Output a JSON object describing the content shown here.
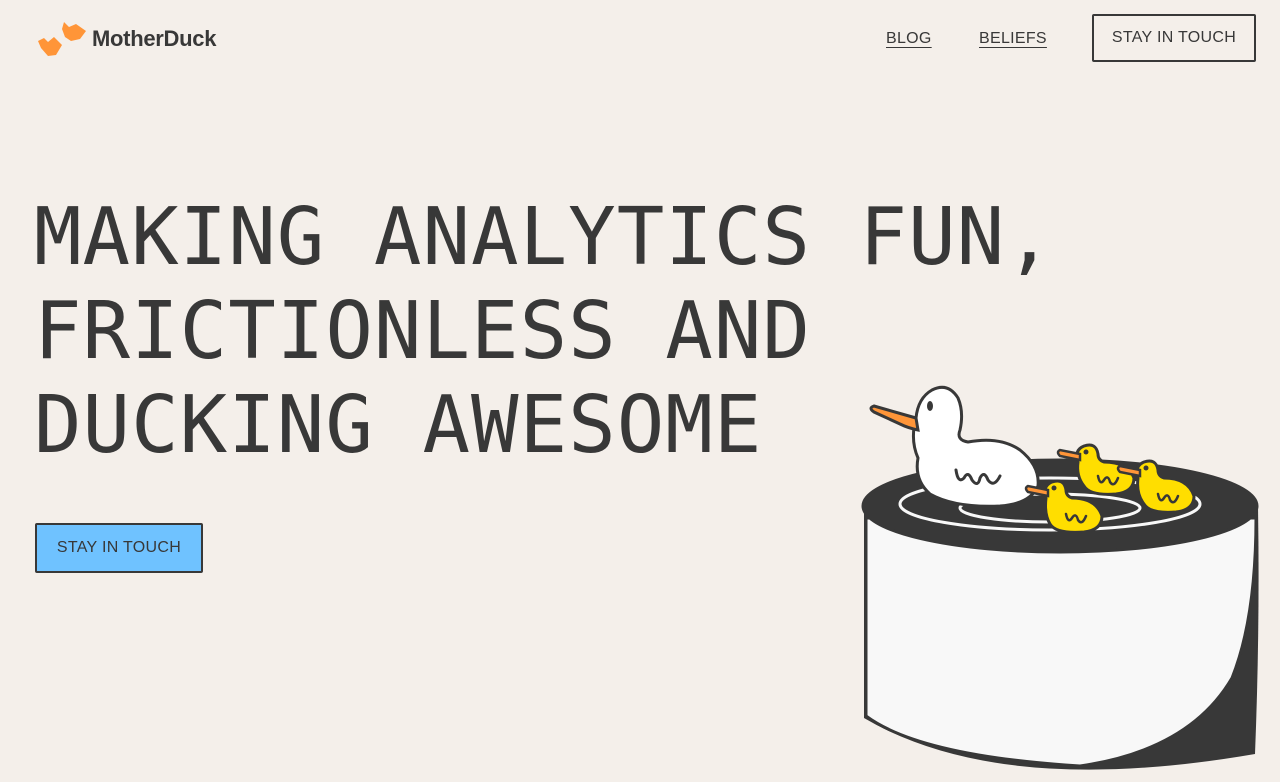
{
  "header": {
    "logo_text": "MotherDuck",
    "nav": {
      "blog": "BLOG",
      "beliefs": "BELIEFS"
    },
    "cta": "STAY IN TOUCH"
  },
  "hero": {
    "title_lines": [
      "MAKING ANALYTICS FUN,",
      "FRICTIONLESS AND",
      "DUCKING AWESOME"
    ],
    "cta": "STAY IN TOUCH"
  },
  "colors": {
    "background": "#F4EFEA",
    "text": "#383838",
    "accent_blue": "#6FC2FF",
    "logo_orange": "#FF9538",
    "duckling_yellow": "#FFDE00"
  },
  "icons": {
    "logo": "two-ducks-logo-icon",
    "illustration": "mother-duck-with-ducklings-in-pond"
  }
}
